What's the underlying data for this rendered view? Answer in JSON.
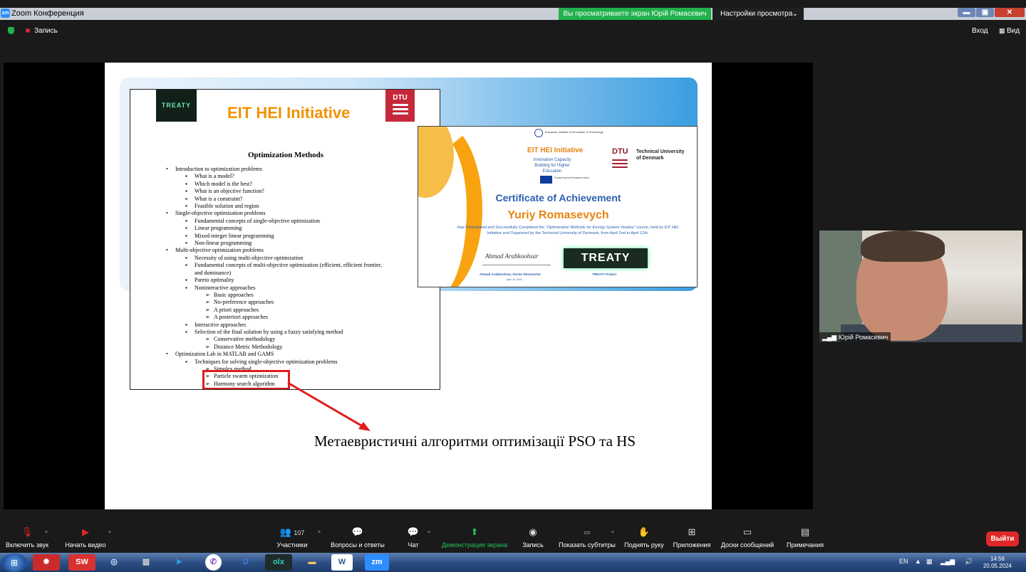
{
  "window": {
    "title": "Zoom Конференция",
    "viewing_banner": "Вы просматриваете экран Юрій Ромасевич",
    "view_options": "Настройки просмотра",
    "view_options_caret": "⌄",
    "controls": [
      "▬",
      "▣",
      "✕"
    ]
  },
  "topbar": {
    "record_label": "Запись",
    "enter_label": "Вход",
    "view_label": "Вид"
  },
  "slide": {
    "course_doc": {
      "treaty_logo": "TREATY",
      "eit_title": "EIT HEI Initiative",
      "dtu_logo": "DTU",
      "title": "Optimization Methods",
      "outline": [
        {
          "level": 1,
          "text": "Introduction to optimization problems"
        },
        {
          "level": 2,
          "text": "What is a model?"
        },
        {
          "level": 2,
          "text": "Which model is the best?"
        },
        {
          "level": 2,
          "text": "What is an objective function?"
        },
        {
          "level": 2,
          "text": "What is a constraint?"
        },
        {
          "level": 2,
          "text": "Feasible solution and region"
        },
        {
          "level": 1,
          "text": "Single-objective optimization problems"
        },
        {
          "level": 2,
          "text": "Fundamental concepts of single-objective optimization"
        },
        {
          "level": 2,
          "text": "Linear programming"
        },
        {
          "level": 2,
          "text": "Mixed-integer linear programming"
        },
        {
          "level": 2,
          "text": "Non-linear programming"
        },
        {
          "level": 1,
          "text": "Multi-objective optimization problems"
        },
        {
          "level": 2,
          "text": "Necessity of using multi-objective optimization"
        },
        {
          "level": 2,
          "text": "Fundamental concepts of multi-objective optimization (efficient, efficient frontier,"
        },
        {
          "level": 0,
          "text": "and dominance)"
        },
        {
          "level": 2,
          "text": "Pareto optimality"
        },
        {
          "level": 2,
          "text": "Noninteractive approaches"
        },
        {
          "level": 3,
          "text": "Basic approaches"
        },
        {
          "level": 3,
          "text": "No-preference approaches"
        },
        {
          "level": 3,
          "text": "A priori approaches"
        },
        {
          "level": 3,
          "text": "A posteriori approaches"
        },
        {
          "level": 2,
          "text": "Interactive approaches"
        },
        {
          "level": 2,
          "text": "Selection of the final solution by using a fuzzy satisfying method"
        },
        {
          "level": 3,
          "text": "Conservative methodology"
        },
        {
          "level": 3,
          "text": "Distance Metric Methodology"
        },
        {
          "level": 1,
          "text": "Optimization Lab in MATLAB and GAMS"
        },
        {
          "level": 2,
          "text": "Techniques for solving single-objective optimization problems"
        },
        {
          "level": 3,
          "text": "Simplex method"
        },
        {
          "level": 3,
          "text": "Particle swarm optimization"
        },
        {
          "level": 3,
          "text": "Harmony search algorithm"
        }
      ]
    },
    "certificate": {
      "eu_caption": "European Institute of Innovation & Technology",
      "eit_title": "EIT HEI Initiative",
      "eit_sub": "Innovation Capacity Building for Higher Education",
      "funded": "Funded by the European Union",
      "dtu": "DTU",
      "university": "Technical University of Denmark",
      "heading": "Certificate of Achievement",
      "name": "Yuriy Romasevych",
      "description": "Has Participated and Successfully Completed the \"Optimization Methods for Energy System Studies\" course, held by EIT HEI Initiative and Organized by the Technical University of Denmark, from April 2nd to April 12th.",
      "signature": "Ahmad Arabkoohsar",
      "signer": "Ahmad Arabkoohsar, Senior Researcher",
      "date": "April 16, 2024",
      "treaty_logo": "TREATY",
      "treaty_project": "TREATY Project"
    },
    "caption": "Метаевристичні алгоритми оптимізації PSO та HS"
  },
  "participant_video": {
    "name": "Юрій Ромасевич"
  },
  "toolbar": {
    "mute": "Включить звук",
    "video": "Начать видео",
    "participants": "Участники",
    "participants_count": "107",
    "qa": "Вопросы и ответы",
    "chat": "Чат",
    "share": "Демонстрация экрана",
    "record": "Запись",
    "captions": "Показать субтитры",
    "raise_hand": "Поднять руку",
    "apps": "Приложения",
    "whiteboard": "Доски сообщений",
    "notes": "Примечания",
    "leave": "Выйти"
  },
  "taskbar": {
    "lang": "EN",
    "time": "14:56",
    "date": "20.05.2024",
    "apps": [
      "windows-start",
      "app-red",
      "solidworks",
      "app-circle",
      "app-building",
      "telegram",
      "viber",
      "app-d",
      "olx",
      "explorer",
      "word",
      "zoom"
    ]
  }
}
